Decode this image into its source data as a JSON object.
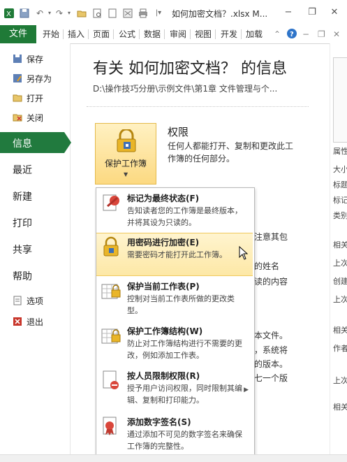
{
  "titlebar": {
    "title": "如何加密文档？.xlsx M..."
  },
  "ribbon": {
    "file_tab": "文件",
    "tabs": [
      "开始",
      "插入",
      "页面",
      "公式",
      "数据",
      "审阅",
      "视图",
      "开发",
      "加载"
    ]
  },
  "nav": {
    "save": "保存",
    "save_as": "另存为",
    "open": "打开",
    "close": "关闭",
    "info": "信息",
    "recent": "最近",
    "new": "新建",
    "print": "打印",
    "share": "共享",
    "help": "帮助",
    "options": "选项",
    "exit": "退出"
  },
  "main": {
    "title": "有关 如何加密文档？ 的信息",
    "path": "D:\\操作技巧分册\\示例文件\\第1章 文件管理与个...",
    "protect_button": "保护工作簿",
    "permissions_title": "权限",
    "permissions_desc": "任何人都能打开、复制和更改此工作簿的任何部分。",
    "bg_fragments": [
      "注意其包",
      "的姓名",
      "读的内容",
      "本文件。",
      "，系统将",
      "的版本。",
      "七一个版"
    ]
  },
  "menu": {
    "items": [
      {
        "title": "标记为最终状态(F)",
        "desc": "告知读者您的工作簿是最终版本，并将其设为只读的。"
      },
      {
        "title": "用密码进行加密(E)",
        "desc": "需要密码才能打开此工作簿。"
      },
      {
        "title": "保护当前工作表(P)",
        "desc": "控制对当前工作表所做的更改类型。"
      },
      {
        "title": "保护工作簿结构(W)",
        "desc": "防止对工作簿结构进行不需要的更改，例如添加工作表。"
      },
      {
        "title": "按人员限制权限(R)",
        "desc": "授予用户访问权限，同时限制其编辑、复制和打印能力。"
      },
      {
        "title": "添加数字签名(S)",
        "desc": "通过添加不可见的数字签名来确保工作簿的完整性。"
      }
    ]
  },
  "right_panel": {
    "labels": [
      "属性",
      "大小",
      "标题",
      "标记",
      "类别",
      "相关",
      "上次",
      "创建",
      "上次",
      "相关",
      "作者",
      "上次",
      "相关"
    ]
  }
}
